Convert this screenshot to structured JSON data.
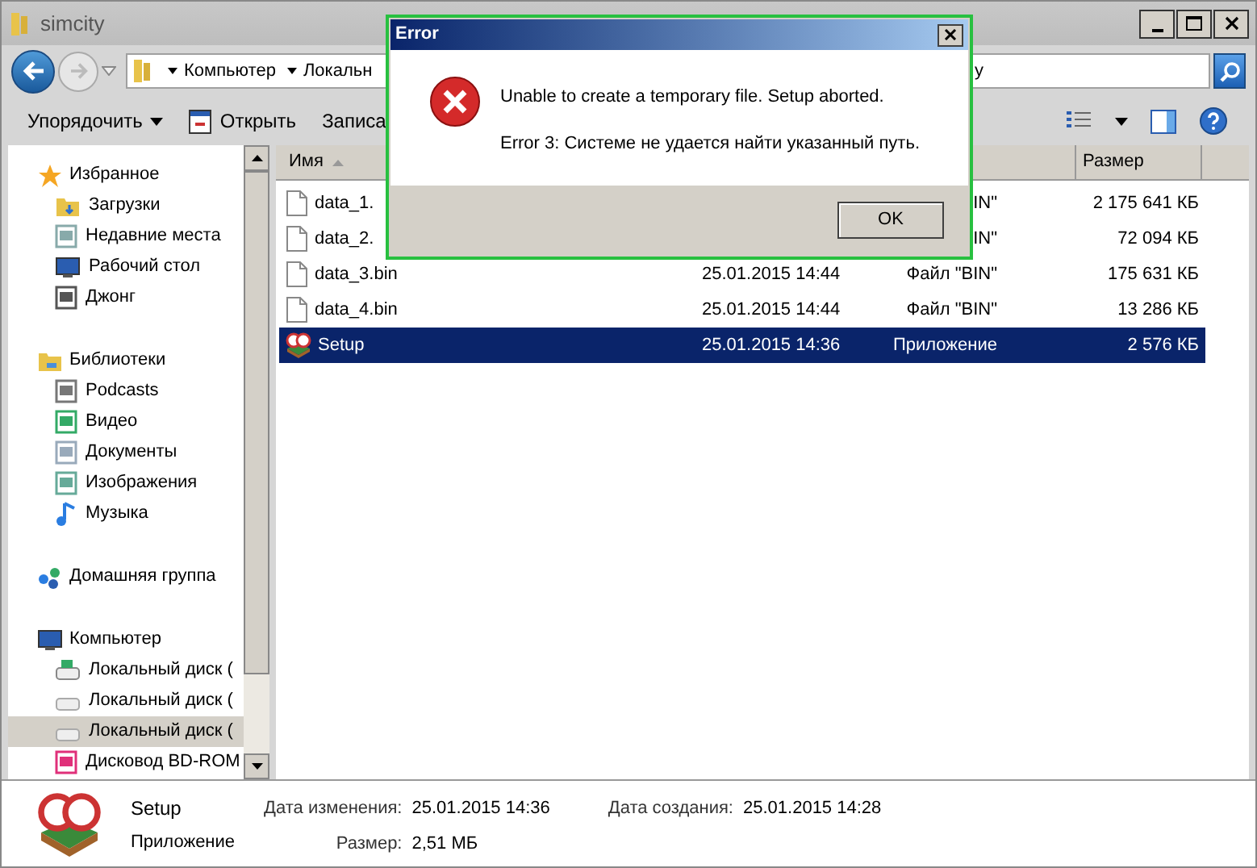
{
  "window": {
    "title": "simcity"
  },
  "address": {
    "segments": [
      "Компьютер",
      "Локальн"
    ],
    "tail": "y"
  },
  "toolbar": {
    "items": [
      {
        "label": "Упорядочить",
        "kind": "menu"
      },
      {
        "label": "Открыть",
        "kind": "open"
      },
      {
        "label": "Записа",
        "kind": "plain"
      }
    ]
  },
  "sidebar": {
    "groups": [
      {
        "label": "Избранное",
        "items": [
          {
            "label": "Загрузки",
            "selected": false
          },
          {
            "label": "Недавние места",
            "selected": false
          },
          {
            "label": "Рабочий стол",
            "selected": false
          },
          {
            "label": "Джонг",
            "selected": false
          }
        ]
      },
      {
        "label": "Библиотеки",
        "items": [
          {
            "label": "Podcasts",
            "selected": false
          },
          {
            "label": "Видео",
            "selected": false
          },
          {
            "label": "Документы",
            "selected": false
          },
          {
            "label": "Изображения",
            "selected": false
          },
          {
            "label": "Музыка",
            "selected": false
          }
        ]
      },
      {
        "label": "Домашняя группа"
      },
      {
        "label": "Компьютер",
        "items": [
          {
            "label": "Локальный диск (",
            "selected": false
          },
          {
            "label": "Локальный диск (",
            "selected": false
          },
          {
            "label": "Локальный диск (",
            "selected": true
          },
          {
            "label": "Дисковод BD-ROM",
            "selected": false
          }
        ]
      }
    ]
  },
  "table": {
    "columns": [
      {
        "label": "Имя",
        "sorted": true
      },
      {
        "label": "Размер",
        "sorted": false
      }
    ],
    "rows": [
      {
        "name": "data_1.",
        "date": "",
        "type": "IN\"",
        "size": "2 175 641 КБ",
        "kind": "file",
        "selected": false
      },
      {
        "name": "data_2.",
        "date": "",
        "type": "IN\"",
        "size": "72 094 КБ",
        "kind": "file",
        "selected": false
      },
      {
        "name": "data_3.bin",
        "date": "25.01.2015 14:44",
        "type": "Файл \"BIN\"",
        "size": "175 631 КБ",
        "kind": "file",
        "selected": false
      },
      {
        "name": "data_4.bin",
        "date": "25.01.2015 14:44",
        "type": "Файл \"BIN\"",
        "size": "13 286 КБ",
        "kind": "file",
        "selected": false
      },
      {
        "name": "Setup",
        "date": "25.01.2015 14:36",
        "type": "Приложение",
        "size": "2 576 КБ",
        "kind": "app",
        "selected": true
      }
    ]
  },
  "details": {
    "name": "Setup",
    "type": "Приложение",
    "fields": [
      {
        "label": "Дата изменения:",
        "value": "25.01.2015 14:36"
      },
      {
        "label": "Дата создания:",
        "value": "25.01.2015 14:28"
      },
      {
        "label": "Размер:",
        "value": "2,51 МБ"
      }
    ]
  },
  "dialog": {
    "title": "Error",
    "message": "Unable to create a temporary file. Setup aborted.",
    "detail": "Error 3: Системе не удается найти указанный путь.",
    "button": "OK"
  }
}
